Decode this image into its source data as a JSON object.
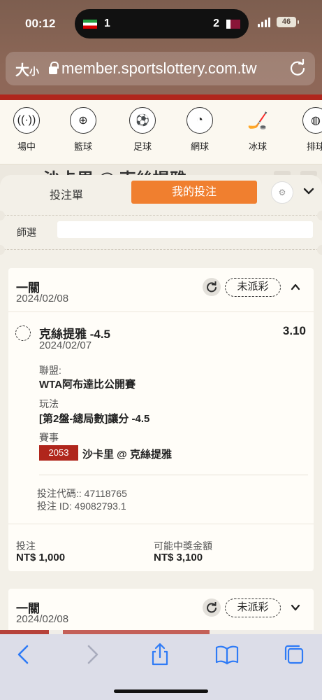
{
  "status_bar": {
    "time": "00:12",
    "score_home": "1",
    "score_away": "2",
    "battery": "46"
  },
  "browser": {
    "text_size_label": "大",
    "text_size_small": "小",
    "url": "member.sportslottery.com.tw"
  },
  "sports_nav": [
    {
      "label": "場中",
      "icon": "live-icon"
    },
    {
      "label": "籃球",
      "icon": "basketball-icon"
    },
    {
      "label": "足球",
      "icon": "soccer-icon"
    },
    {
      "label": "網球",
      "icon": "tennis-icon"
    },
    {
      "label": "冰球",
      "icon": "hockey-icon"
    },
    {
      "label": "排球",
      "icon": "volleyball-icon"
    }
  ],
  "background_title": "沙卡里 @ 克絲提雅",
  "panel": {
    "tab_betslip": "投注單",
    "tab_mybets": "我的投注",
    "filter_label": "師選"
  },
  "bets": [
    {
      "type": "一關",
      "date": "2024/02/08",
      "status": "未派彩",
      "selection": "克絲提雅 -4.5",
      "odds": "3.10",
      "selection_date": "2024/02/07",
      "league_label": "聯盟:",
      "league": "WTA阿布達比公開賽",
      "market_label": "玩法",
      "market": "[第2盤-總局數]讓分 -4.5",
      "event_label": "賽事",
      "event_code": "2053",
      "event_name": "沙卡里 @ 克絲提雅",
      "bet_code": "投注代碼:: 47118765",
      "bet_id": "投注 ID: 49082793.1",
      "stake_label": "投注",
      "stake": "NT$ 1,000",
      "payout_label": "可能中獎金額",
      "payout": "NT$ 3,100"
    },
    {
      "type": "一關",
      "date": "2024/02/08",
      "status": "未派彩"
    }
  ],
  "colors": {
    "accent_orange": "#f07f2f",
    "brand_red": "#b0261c",
    "safari_blue": "#2f7bf6"
  }
}
